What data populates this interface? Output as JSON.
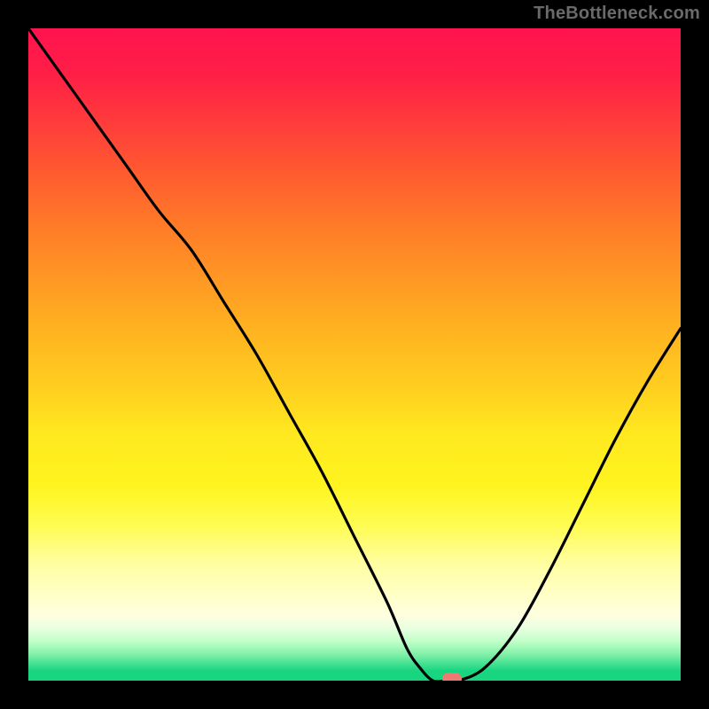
{
  "watermark": "TheBottleneck.com",
  "colors": {
    "background": "#000000",
    "curve": "#000000",
    "marker": "#ef7a74",
    "gradient_top": "#ff134f",
    "gradient_bottom": "#18d680"
  },
  "chart_data": {
    "type": "line",
    "title": "",
    "xlabel": "",
    "ylabel": "",
    "xlim": [
      0,
      100
    ],
    "ylim": [
      0,
      100
    ],
    "x": [
      0,
      5,
      10,
      15,
      20,
      25,
      30,
      35,
      40,
      45,
      50,
      55,
      58,
      60,
      62,
      64,
      66,
      70,
      75,
      80,
      85,
      90,
      95,
      100
    ],
    "values": [
      100,
      93,
      86,
      79,
      72,
      66,
      58,
      50,
      41,
      32,
      22,
      12,
      5,
      2,
      0,
      0,
      0,
      2,
      8,
      17,
      27,
      37,
      46,
      54
    ],
    "marker": {
      "x": 65,
      "y": 0
    },
    "annotations": []
  }
}
